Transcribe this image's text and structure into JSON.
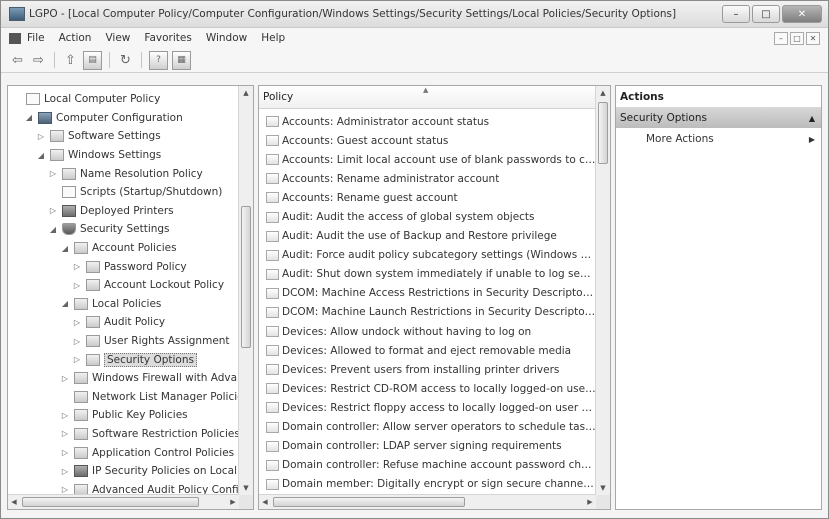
{
  "window": {
    "title": "LGPO - [Local Computer Policy/Computer Configuration/Windows Settings/Security Settings/Local Policies/Security Options]",
    "controls": [
      "–",
      "□",
      "✕"
    ]
  },
  "menubar": {
    "items": [
      "File",
      "Action",
      "View",
      "Favorites",
      "Window",
      "Help"
    ],
    "mdi_controls": [
      "–",
      "□",
      "✕"
    ]
  },
  "toolbar": {
    "icons": [
      "back-icon",
      "forward-icon",
      "up-folder-icon",
      "show-hide-tree-icon",
      "refresh-icon",
      "help-icon",
      "console-tree-icon"
    ]
  },
  "tree": {
    "nodes": [
      {
        "label": "Local Computer Policy",
        "depth": 0,
        "twisty": "",
        "icon": "doc"
      },
      {
        "label": "Computer Configuration",
        "depth": 1,
        "twisty": "◢",
        "icon": "pc"
      },
      {
        "label": "Software Settings",
        "depth": 2,
        "twisty": "▷",
        "icon": "folder"
      },
      {
        "label": "Windows Settings",
        "depth": 2,
        "twisty": "◢",
        "icon": "folder"
      },
      {
        "label": "Name Resolution Policy",
        "depth": 3,
        "twisty": "▷",
        "icon": "folder"
      },
      {
        "label": "Scripts (Startup/Shutdown)",
        "depth": 3,
        "twisty": "",
        "icon": "doc"
      },
      {
        "label": "Deployed Printers",
        "depth": 3,
        "twisty": "▷",
        "icon": "sec"
      },
      {
        "label": "Security Settings",
        "depth": 3,
        "twisty": "◢",
        "icon": "shield"
      },
      {
        "label": "Account Policies",
        "depth": 4,
        "twisty": "◢",
        "icon": "folder"
      },
      {
        "label": "Password Policy",
        "depth": 5,
        "twisty": "▷",
        "icon": "folder"
      },
      {
        "label": "Account Lockout Policy",
        "depth": 5,
        "twisty": "▷",
        "icon": "folder"
      },
      {
        "label": "Local Policies",
        "depth": 4,
        "twisty": "◢",
        "icon": "folder"
      },
      {
        "label": "Audit Policy",
        "depth": 5,
        "twisty": "▷",
        "icon": "folder"
      },
      {
        "label": "User Rights Assignment",
        "depth": 5,
        "twisty": "▷",
        "icon": "folder"
      },
      {
        "label": "Security Options",
        "depth": 5,
        "twisty": "▷",
        "icon": "folder",
        "selected": true
      },
      {
        "label": "Windows Firewall with Advanced Security",
        "depth": 4,
        "twisty": "▷",
        "icon": "folder"
      },
      {
        "label": "Network List Manager Policies",
        "depth": 4,
        "twisty": "",
        "icon": "folder"
      },
      {
        "label": "Public Key Policies",
        "depth": 4,
        "twisty": "▷",
        "icon": "folder"
      },
      {
        "label": "Software Restriction Policies",
        "depth": 4,
        "twisty": "▷",
        "icon": "folder"
      },
      {
        "label": "Application Control Policies",
        "depth": 4,
        "twisty": "▷",
        "icon": "folder"
      },
      {
        "label": "IP Security Policies on Local Computer",
        "depth": 4,
        "twisty": "▷",
        "icon": "sec"
      },
      {
        "label": "Advanced Audit Policy Configuration",
        "depth": 4,
        "twisty": "▷",
        "icon": "folder"
      }
    ]
  },
  "policy_list": {
    "header": "Policy",
    "rows": [
      "Accounts: Administrator account status",
      "Accounts: Guest account status",
      "Accounts: Limit local account use of blank passwords to console logon only",
      "Accounts: Rename administrator account",
      "Accounts: Rename guest account",
      "Audit: Audit the access of global system objects",
      "Audit: Audit the use of Backup and Restore privilege",
      "Audit: Force audit policy subcategory settings (Windows Vista or later) to override audit policy category settings",
      "Audit: Shut down system immediately if unable to log security audits",
      "DCOM: Machine Access Restrictions in Security Descriptor Definition Language (SDDL) syntax",
      "DCOM: Machine Launch Restrictions in Security Descriptor Definition Language (SDDL) syntax",
      "Devices: Allow undock without having to log on",
      "Devices: Allowed to format and eject removable media",
      "Devices: Prevent users from installing printer drivers",
      "Devices: Restrict CD-ROM access to locally logged-on user only",
      "Devices: Restrict floppy access to locally logged-on user only",
      "Domain controller: Allow server operators to schedule tasks",
      "Domain controller: LDAP server signing requirements",
      "Domain controller: Refuse machine account password changes",
      "Domain member: Digitally encrypt or sign secure channel data (always)"
    ]
  },
  "actions": {
    "header": "Actions",
    "section": "Security Options",
    "items": [
      "More Actions"
    ]
  }
}
